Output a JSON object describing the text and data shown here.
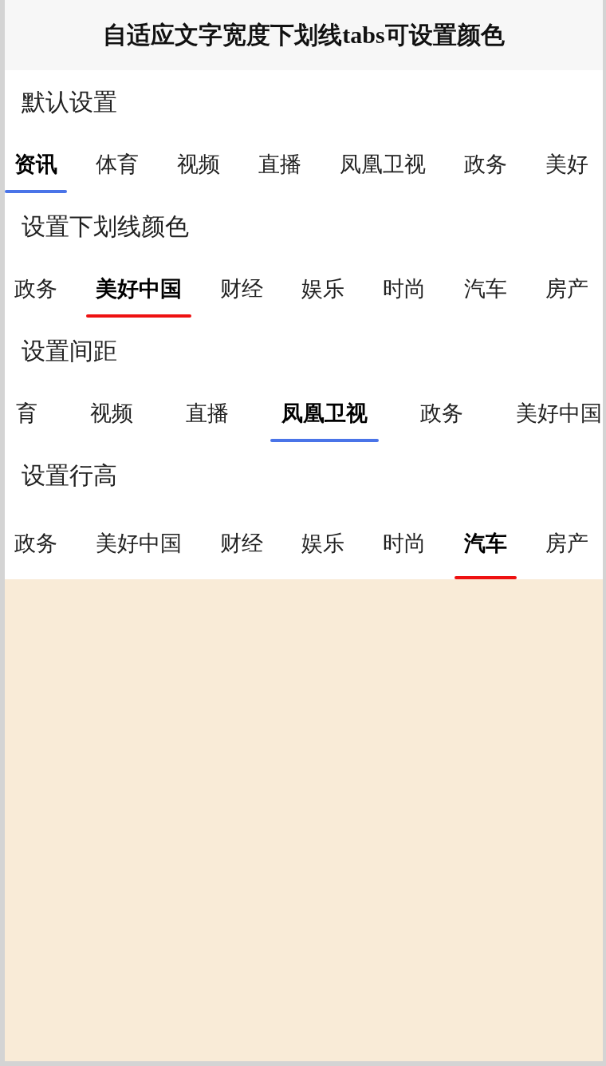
{
  "header": {
    "title": "自适应文字宽度下划线tabs可设置颜色"
  },
  "sections": [
    {
      "kind": "default",
      "title": "默认设置",
      "color": "#4a74e8",
      "tabs": [
        {
          "label": "资讯",
          "selected": true
        },
        {
          "label": "体育",
          "selected": false
        },
        {
          "label": "视频",
          "selected": false
        },
        {
          "label": "直播",
          "selected": false
        },
        {
          "label": "凤凰卫视",
          "selected": false
        },
        {
          "label": "政务",
          "selected": false
        },
        {
          "label": "美好",
          "selected": false
        }
      ]
    },
    {
      "kind": "color",
      "title": "设置下划线颜色",
      "color": "#ee1111",
      "tabs": [
        {
          "label": "政务",
          "selected": false
        },
        {
          "label": "美好中国",
          "selected": true
        },
        {
          "label": "财经",
          "selected": false
        },
        {
          "label": "娱乐",
          "selected": false
        },
        {
          "label": "时尚",
          "selected": false
        },
        {
          "label": "汽车",
          "selected": false
        },
        {
          "label": "房产",
          "selected": false
        }
      ]
    },
    {
      "kind": "spacing",
      "title": "设置间距",
      "color": "#4a74e8",
      "tabs": [
        {
          "label": "育",
          "selected": false
        },
        {
          "label": "视频",
          "selected": false
        },
        {
          "label": "直播",
          "selected": false
        },
        {
          "label": "凤凰卫视",
          "selected": true
        },
        {
          "label": "政务",
          "selected": false
        },
        {
          "label": "美好中国",
          "selected": false
        }
      ]
    },
    {
      "kind": "lineheight",
      "title": "设置行高",
      "color": "#ee1111",
      "tabs": [
        {
          "label": "政务",
          "selected": false
        },
        {
          "label": "美好中国",
          "selected": false
        },
        {
          "label": "财经",
          "selected": false
        },
        {
          "label": "娱乐",
          "selected": false
        },
        {
          "label": "时尚",
          "selected": false
        },
        {
          "label": "汽车",
          "selected": true
        },
        {
          "label": "房产",
          "selected": false
        }
      ]
    }
  ]
}
